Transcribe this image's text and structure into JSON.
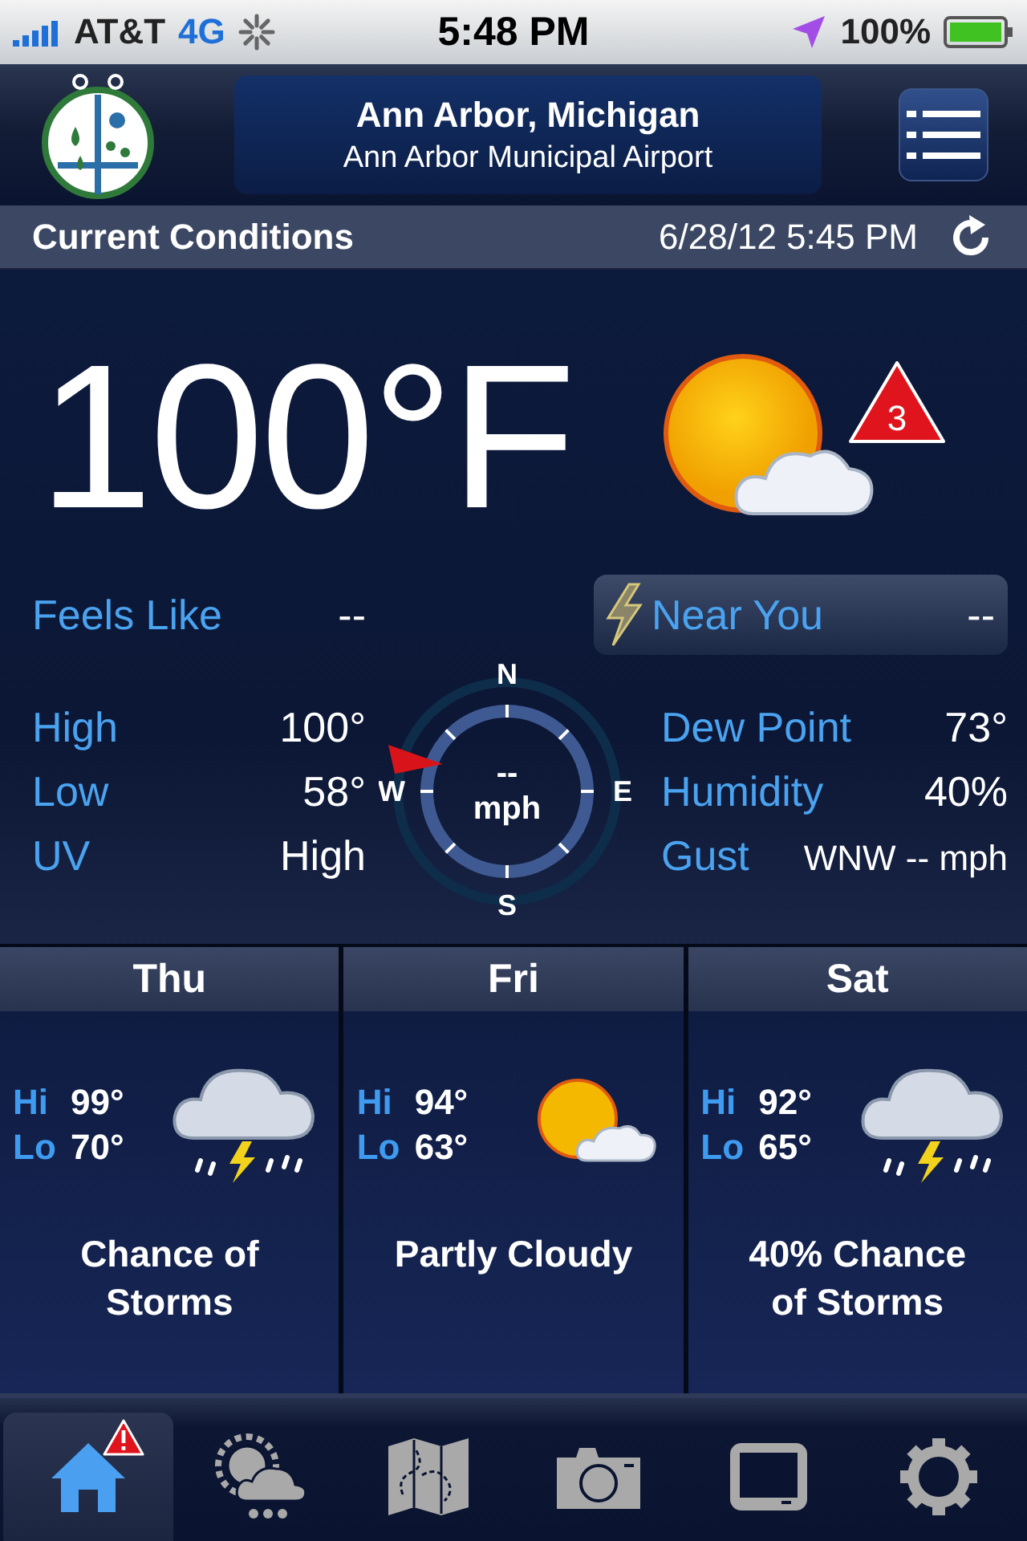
{
  "status_bar": {
    "carrier": "AT&T",
    "network": "4G",
    "time": "5:48 PM",
    "battery": "100%"
  },
  "header": {
    "title": "Ann Arbor, Michigan",
    "subtitle": "Ann Arbor Municipal Airport"
  },
  "conditions_bar": {
    "title": "Current Conditions",
    "timestamp": "6/28/12 5:45 PM"
  },
  "current": {
    "temperature": "100°F",
    "alert_count": "3",
    "feels_like": {
      "label": "Feels Like",
      "value": "--"
    },
    "near_you": {
      "label": "Near You",
      "value": "--"
    },
    "left_stats": [
      {
        "label": "High",
        "value": "100°"
      },
      {
        "label": "Low",
        "value": "58°"
      },
      {
        "label": "UV",
        "value": "High"
      }
    ],
    "right_stats": [
      {
        "label": "Dew Point",
        "value": "73°"
      },
      {
        "label": "Humidity",
        "value": "40%"
      },
      {
        "label": "Gust",
        "value": "WNW -- mph"
      }
    ],
    "wind": {
      "speed": "--",
      "unit": "mph",
      "north": "N",
      "east": "E",
      "south": "S",
      "west": "W"
    }
  },
  "forecast": [
    {
      "day": "Thu",
      "hi_label": "Hi",
      "hi": "99°",
      "lo_label": "Lo",
      "lo": "70°",
      "kind": "storms",
      "summary": "Chance of Storms"
    },
    {
      "day": "Fri",
      "hi_label": "Hi",
      "hi": "94°",
      "lo_label": "Lo",
      "lo": "63°",
      "kind": "partly-cloudy",
      "summary": "Partly Cloudy"
    },
    {
      "day": "Sat",
      "hi_label": "Hi",
      "hi": "92°",
      "lo_label": "Lo",
      "lo": "65°",
      "kind": "storms",
      "summary": "40% Chance of Storms"
    }
  ],
  "tabs": [
    {
      "kind": "home",
      "selected": true,
      "alert": true
    },
    {
      "kind": "forecast",
      "selected": false,
      "alert": false
    },
    {
      "kind": "map",
      "selected": false,
      "alert": false
    },
    {
      "kind": "camera",
      "selected": false,
      "alert": false
    },
    {
      "kind": "video",
      "selected": false,
      "alert": false
    },
    {
      "kind": "settings",
      "selected": false,
      "alert": false
    }
  ]
}
